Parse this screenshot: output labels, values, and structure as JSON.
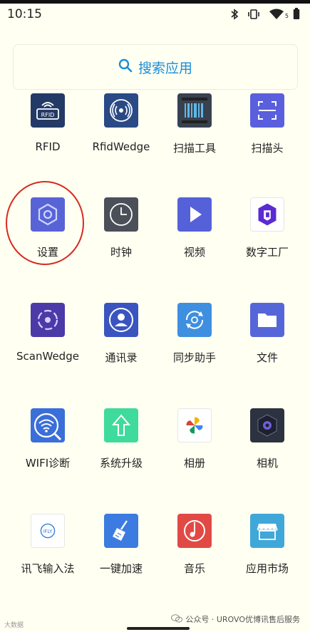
{
  "status_bar": {
    "time": "10:15",
    "signal_badge": "5"
  },
  "search": {
    "label": "搜索应用",
    "icon": "search-icon"
  },
  "apps": [
    {
      "id": "rfid",
      "label": "RFID",
      "icon": "rfid-icon"
    },
    {
      "id": "rfidwedge",
      "label": "RfidWedge",
      "icon": "rfid-wave-icon"
    },
    {
      "id": "scan-tool",
      "label": "扫描工具",
      "icon": "barcode-icon"
    },
    {
      "id": "scanner",
      "label": "扫描头",
      "icon": "scan-frame-icon"
    },
    {
      "id": "settings",
      "label": "设置",
      "icon": "gear-icon"
    },
    {
      "id": "clock",
      "label": "时钟",
      "icon": "clock-icon"
    },
    {
      "id": "video",
      "label": "视频",
      "icon": "play-icon"
    },
    {
      "id": "digital-factory",
      "label": "数字工厂",
      "icon": "hexagon-logo-icon"
    },
    {
      "id": "scanwedge",
      "label": "ScanWedge",
      "icon": "scan-target-icon"
    },
    {
      "id": "contacts",
      "label": "通讯录",
      "icon": "person-icon"
    },
    {
      "id": "sync-helper",
      "label": "同步助手",
      "icon": "sync-icon"
    },
    {
      "id": "files",
      "label": "文件",
      "icon": "folder-icon"
    },
    {
      "id": "wifi-diag",
      "label": "WIFI诊断",
      "icon": "wifi-search-icon"
    },
    {
      "id": "system-update",
      "label": "系统升级",
      "icon": "arrow-up-icon"
    },
    {
      "id": "photos",
      "label": "相册",
      "icon": "pinwheel-icon"
    },
    {
      "id": "camera",
      "label": "相机",
      "icon": "camera-lens-icon"
    },
    {
      "id": "ifly-ime",
      "label": "讯飞输入法",
      "icon": "ifly-icon"
    },
    {
      "id": "speedup",
      "label": "一键加速",
      "icon": "broom-icon"
    },
    {
      "id": "music",
      "label": "音乐",
      "icon": "music-note-icon"
    },
    {
      "id": "app-market",
      "label": "应用市场",
      "icon": "store-icon"
    }
  ],
  "icon_texts": {
    "rfid": "RFID",
    "ifly": "iFLY"
  },
  "highlight": {
    "target": "设置",
    "color": "#d62a20"
  },
  "watermark": {
    "right": "公众号 · UROVO优博讯售后服务",
    "left": "大数据"
  },
  "colors": {
    "search_accent": "#1a8fd8",
    "background": "#fffff2"
  }
}
